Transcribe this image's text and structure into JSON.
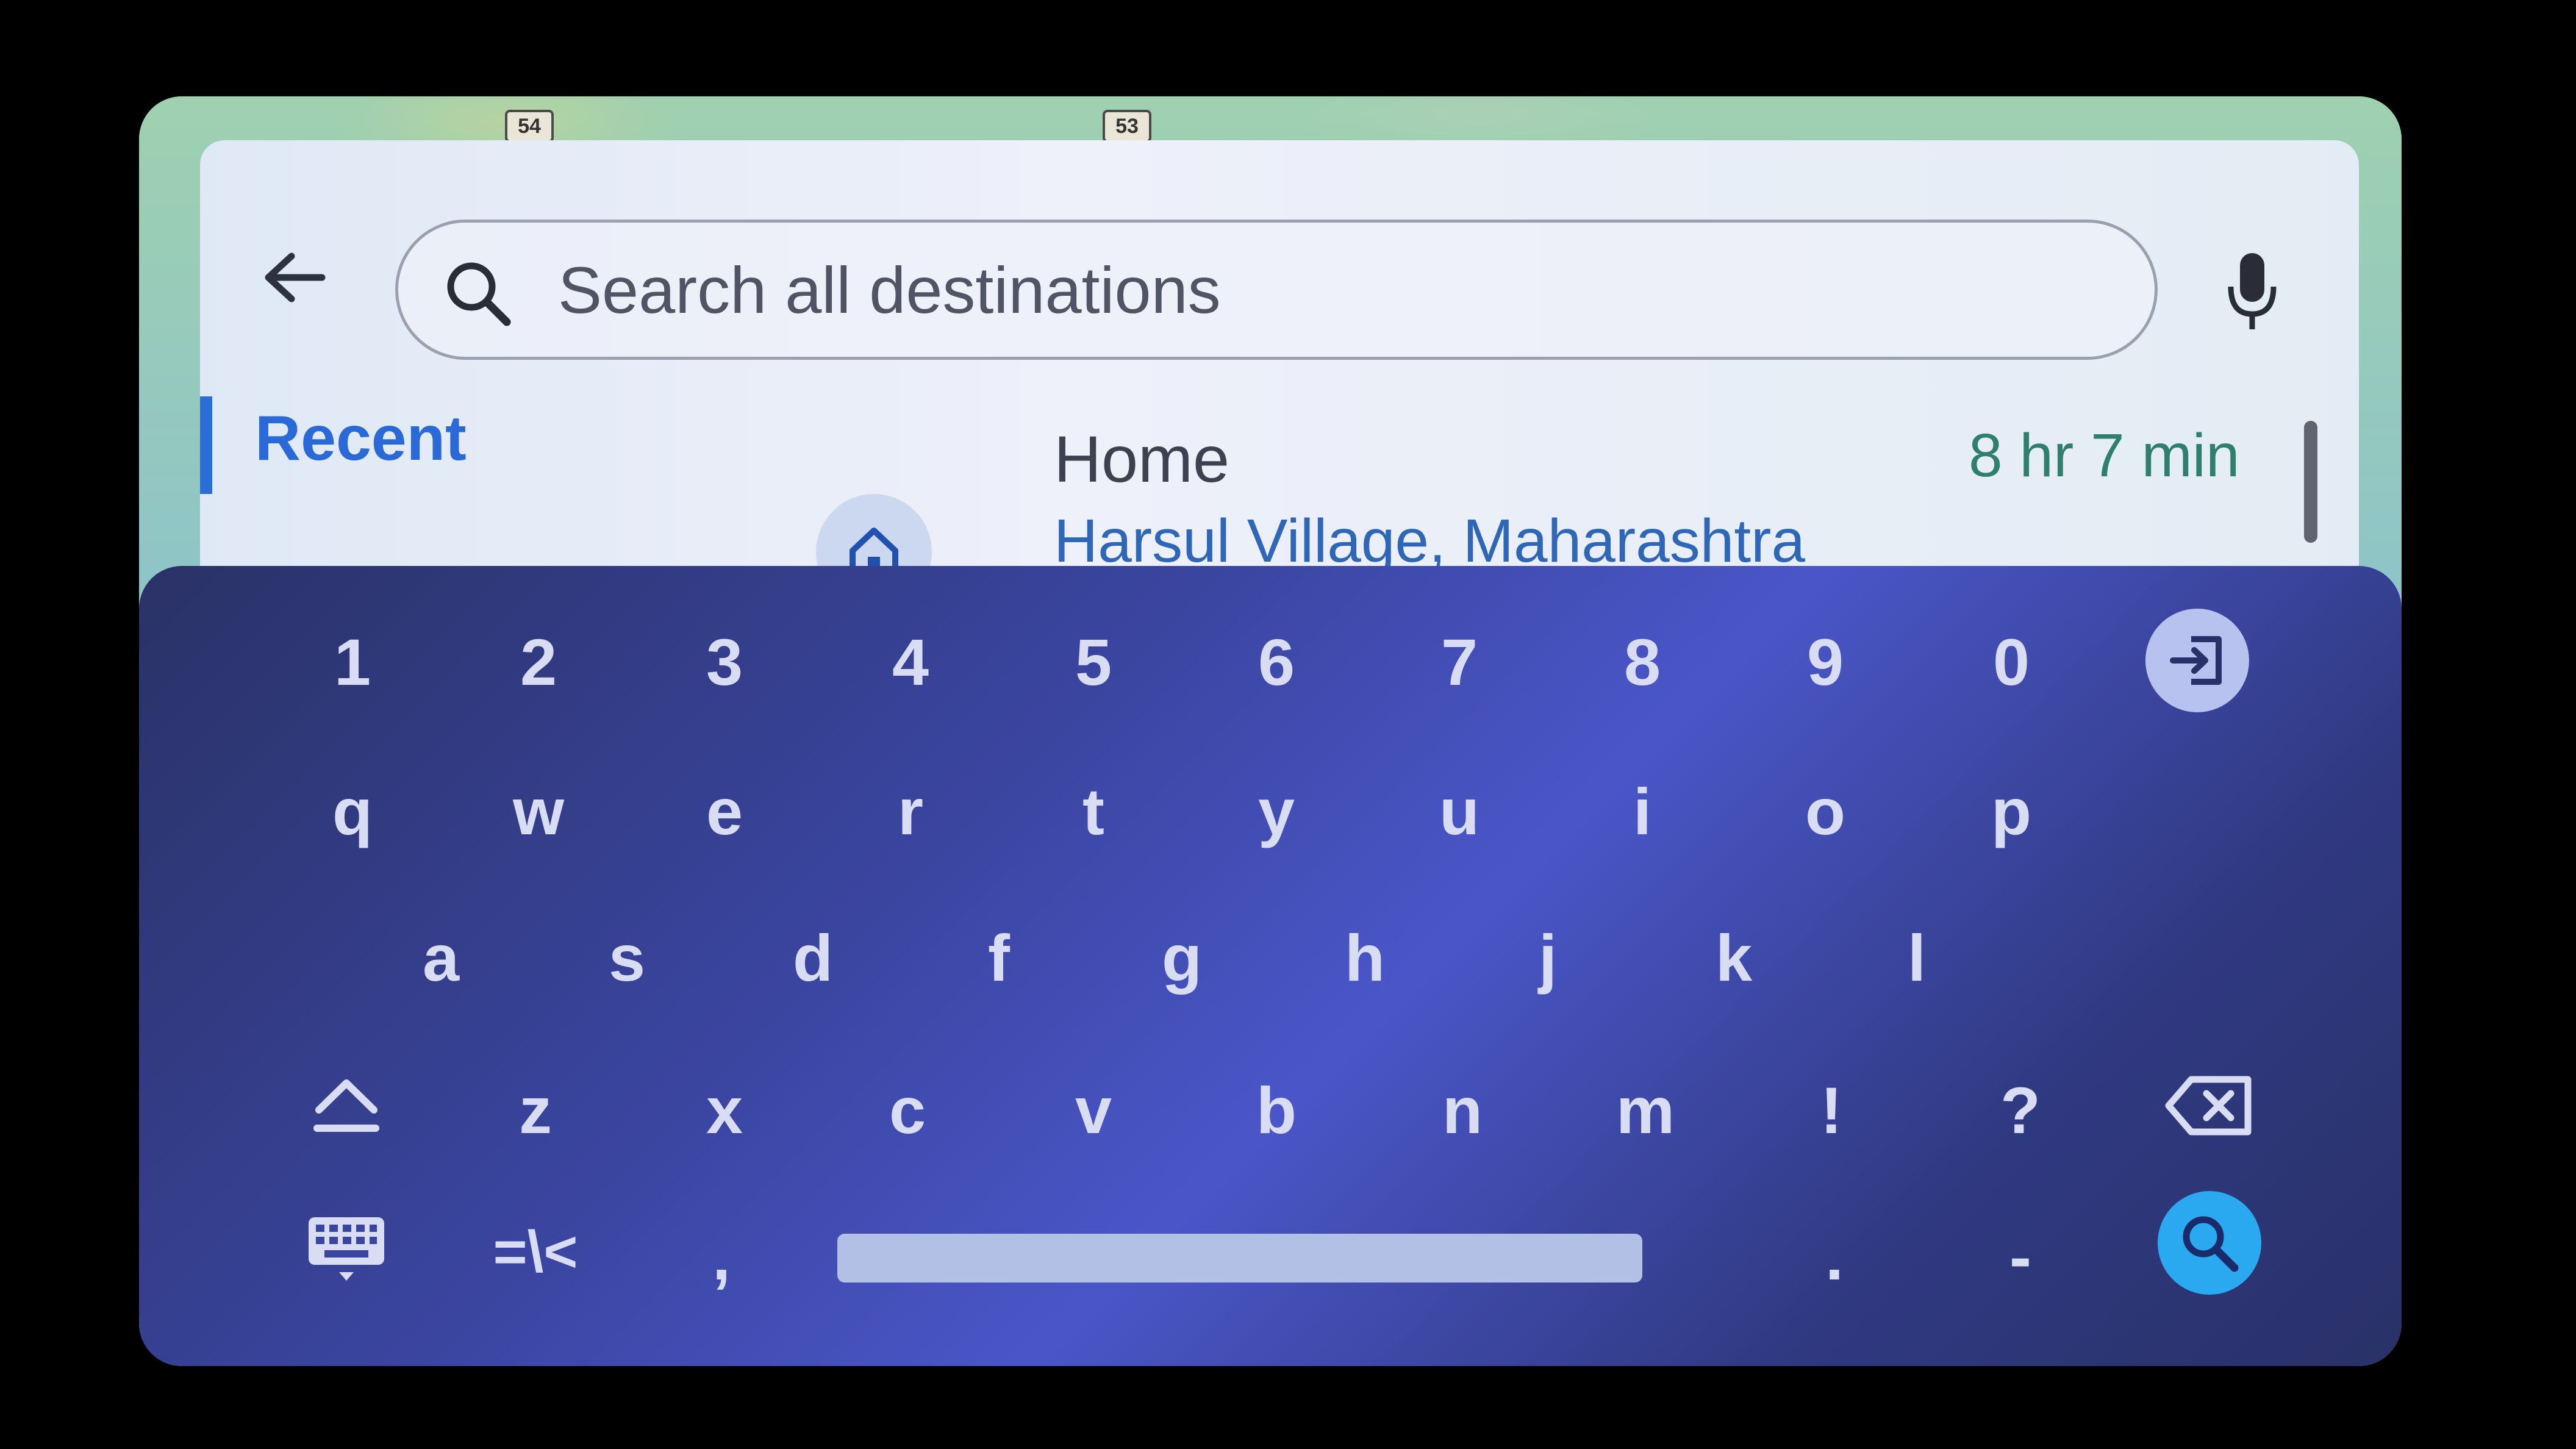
{
  "map": {
    "route_shields": [
      "54",
      "53"
    ]
  },
  "search": {
    "placeholder": "Search all destinations"
  },
  "tabs": {
    "recent_label": "Recent"
  },
  "recent_item": {
    "title": "Home",
    "address": "Harsul Village, Maharashtra",
    "eta": "8 hr 7 min",
    "icon": "home-icon"
  },
  "keyboard": {
    "number_row": [
      "1",
      "2",
      "3",
      "4",
      "5",
      "6",
      "7",
      "8",
      "9",
      "0"
    ],
    "row1": [
      "q",
      "w",
      "e",
      "r",
      "t",
      "y",
      "u",
      "i",
      "o",
      "p"
    ],
    "row2": [
      "a",
      "s",
      "d",
      "f",
      "g",
      "h",
      "j",
      "k",
      "l"
    ],
    "row3": [
      "z",
      "x",
      "c",
      "v",
      "b",
      "n",
      "m",
      "!",
      "?"
    ],
    "symbols_key": "=\\<",
    "comma_key": ",",
    "period_key": ".",
    "dash_key": "-",
    "icons": {
      "exit": "exit-keyboard-icon",
      "shift": "shift-icon",
      "backspace": "backspace-icon",
      "keyboard": "keyboard-icon",
      "search": "search-icon"
    }
  },
  "colors": {
    "accent": "#2a6ad8",
    "eta": "#2f7e6e",
    "keyboard_bg": "#3a45a0",
    "search_action": "#2aa8f0"
  }
}
